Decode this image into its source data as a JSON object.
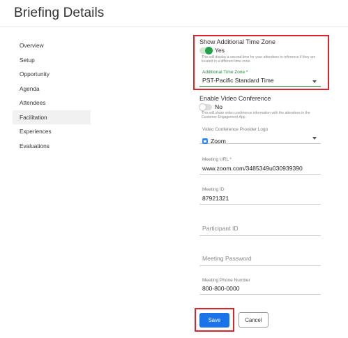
{
  "page": {
    "title": "Briefing Details"
  },
  "sidebar": {
    "items": [
      {
        "label": "Overview"
      },
      {
        "label": "Setup"
      },
      {
        "label": "Opportunity"
      },
      {
        "label": "Agenda"
      },
      {
        "label": "Attendees"
      },
      {
        "label": "Facilitation",
        "active": true
      },
      {
        "label": "Experiences"
      },
      {
        "label": "Evaluations"
      }
    ]
  },
  "form": {
    "time_zone": {
      "label": "Show Additional Time Zone",
      "toggle_state": "on",
      "toggle_text": "Yes",
      "hint": "This will display a second time for your attendees to reference if they are located in a different time zone.",
      "field_label": "Additional Time Zone *",
      "field_value": "PST-Pacific Standard Time"
    },
    "video_conference": {
      "label": "Enable Video Conference",
      "toggle_state": "off",
      "toggle_text": "No",
      "hint": "This will share video conference information with the attendees in the Customer Engagement App.",
      "provider_label": "Video Conference Provider Logo",
      "provider_value": "Zoom",
      "provider_icon": "zoom-icon"
    },
    "meeting_url": {
      "label": "Meeting URL *",
      "value": "www.zoom.com/3485349u030939390"
    },
    "meeting_id": {
      "label": "Meeting ID",
      "value": "87921321"
    },
    "participant_id": {
      "placeholder": "Participant ID"
    },
    "meeting_password": {
      "placeholder": "Meeting Password"
    },
    "meeting_phone": {
      "label": "Meeting Phone Number",
      "value": "800-800-0000"
    }
  },
  "actions": {
    "save_label": "Save",
    "cancel_label": "Cancel"
  },
  "colors": {
    "primary": "#1a73e8",
    "highlight": "#d9262d",
    "toggle_on": "#22a04a",
    "accent_green": "#2e8540"
  }
}
